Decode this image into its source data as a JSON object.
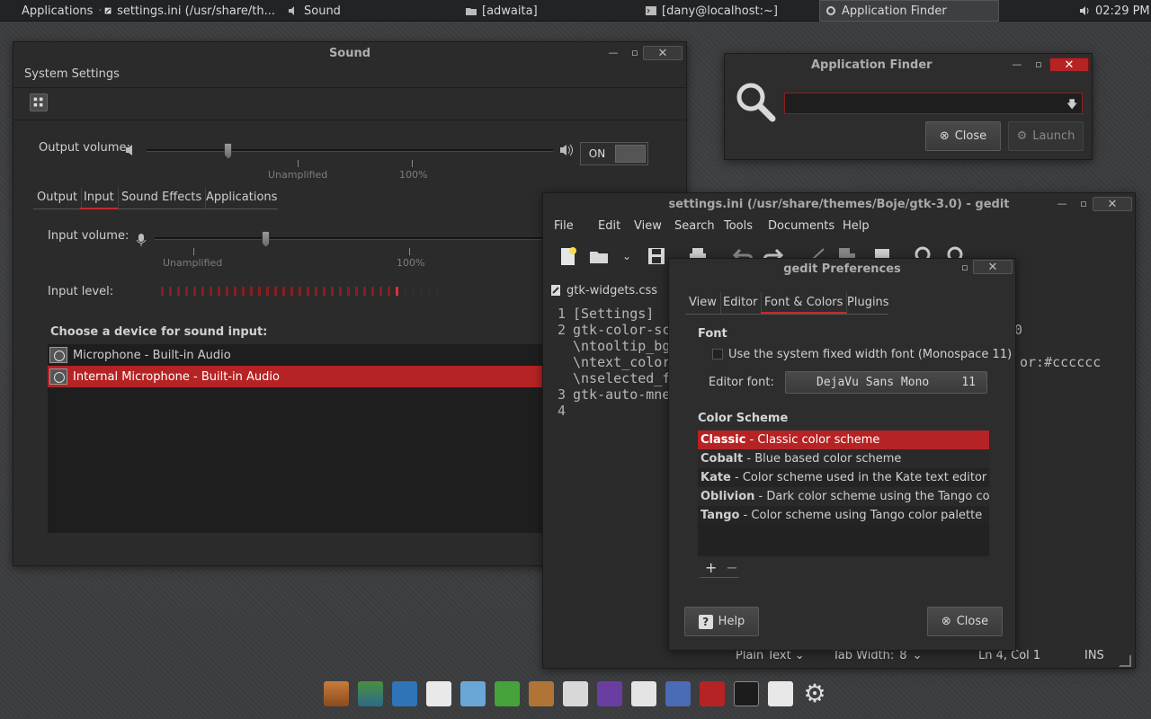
{
  "topbar": {
    "applications": "Applications",
    "dot": "·",
    "task_gedit": "settings.ini (/usr/share/th...",
    "task_sound": "Sound",
    "task_folder": "[adwaita]",
    "task_terminal": "[dany@localhost:~]",
    "task_appfinder": "Application Finder",
    "clock": "02:29 PM"
  },
  "sound": {
    "title": "Sound",
    "system_settings": "System Settings",
    "output_volume_label": "Output volume:",
    "unamplified": "Unamplified",
    "hundred": "100%",
    "output_volume": 0.2,
    "switch_on": "ON",
    "tabs": [
      "Output",
      "Input",
      "Sound Effects",
      "Applications"
    ],
    "selected_tab": "Input",
    "input_volume_label": "Input volume:",
    "input_volume": 0.28,
    "input_level_label": "Input level:",
    "input_level_segments": 35,
    "input_level_active": 30,
    "choose_device": "Choose a device for sound input:",
    "devices": [
      {
        "label": "Microphone - Built-in Audio"
      },
      {
        "label": "Internal Microphone - Built-in Audio"
      }
    ],
    "selected_device": 1
  },
  "appfinder": {
    "title": "Application Finder",
    "search_value": "",
    "close_label": "Close",
    "launch_label": "Launch"
  },
  "gedit": {
    "title": "settings.ini (/usr/share/themes/Boje/gtk-3.0) - gedit",
    "menu": [
      "File",
      "Edit",
      "View",
      "Search",
      "Tools",
      "Documents",
      "Help"
    ],
    "tab_label": "gtk-widgets.css",
    "line_numbers": [
      "1",
      "2",
      "",
      "",
      "",
      "3",
      "4"
    ],
    "lines": [
      "[Settings]",
      "gtk-color-sc",
      "\\ntooltip_bg",
      "\\ntext_color",
      "\\nselected_f",
      "gtk-auto-mne",
      ""
    ],
    "right_fragment_1": "0",
    "right_fragment_2": "or:#cccccc",
    "status_lang": "Plain Text",
    "status_tab": "Tab Width:",
    "status_tab_value": "8",
    "status_pos": "Ln 4, Col 1",
    "status_ins": "INS"
  },
  "prefs": {
    "title": "gedit Preferences",
    "tabs": [
      "View",
      "Editor",
      "Font & Colors",
      "Plugins"
    ],
    "selected_tab": "Font & Colors",
    "font_header": "Font",
    "use_system_font": "Use the system fixed width font (Monospace 11)",
    "editor_font_label": "Editor font:",
    "editor_font_name": "DejaVu Sans Mono",
    "editor_font_size": "11",
    "scheme_header": "Color Scheme",
    "schemes": [
      {
        "name": "Classic",
        "desc": " - Classic color scheme"
      },
      {
        "name": "Cobalt",
        "desc": " - Blue based color scheme"
      },
      {
        "name": "Kate",
        "desc": " - Color scheme used in the Kate text editor"
      },
      {
        "name": "Oblivion",
        "desc": " - Dark color scheme using the Tango color ..."
      },
      {
        "name": "Tango",
        "desc": " - Color scheme using Tango color palette"
      }
    ],
    "selected_scheme": 0,
    "add": "+",
    "remove": "−",
    "help_label": "Help",
    "close_label": "Close"
  },
  "colors": {
    "accent": "#b62324"
  }
}
